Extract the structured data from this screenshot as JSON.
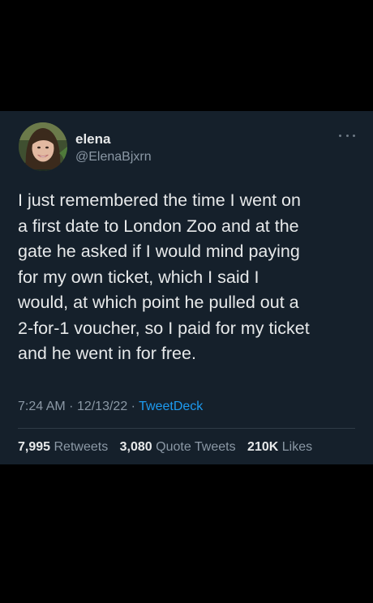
{
  "author": {
    "display_name": "elena",
    "handle": "@ElenaBjxrn",
    "avatar_icon": "profile-photo"
  },
  "tweet": {
    "lines": [
      "I just remembered the time I went on",
      "a first date to London Zoo and at the",
      "gate he asked if I would mind paying",
      "for my own ticket, which I said I",
      "would, at which point he pulled out a",
      "2-for-1 voucher, so I paid for my ticket",
      "and he went in for free."
    ]
  },
  "meta": {
    "time": "7:24 AM",
    "separator": "·",
    "date": "12/13/22",
    "source": "TweetDeck"
  },
  "stats": {
    "retweets_count": "7,995",
    "retweets_label": "Retweets",
    "quotes_count": "3,080",
    "quotes_label": "Quote Tweets",
    "likes_count": "210K",
    "likes_label": "Likes"
  },
  "colors": {
    "background": "#000000",
    "card": "#15202b",
    "text": "#e7e9ea",
    "muted": "#8b98a5",
    "link": "#1d9bf0"
  },
  "icons": {
    "more": "more-horizontal-icon"
  }
}
